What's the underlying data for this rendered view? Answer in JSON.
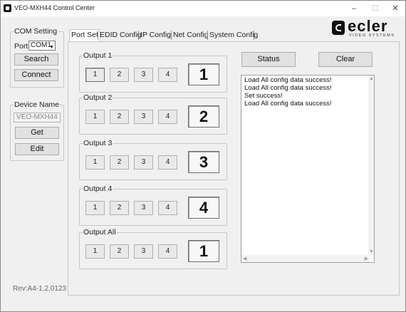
{
  "window": {
    "title": "VEO-MXH44 Control Center",
    "minimize": "–",
    "maximize": "☐",
    "close": "✕"
  },
  "com_setting": {
    "legend": "COM Setting",
    "port_label": "Port:",
    "port_value": "COM1",
    "search_label": "Search",
    "connect_label": "Connect"
  },
  "device_name": {
    "legend": "Device Name",
    "value": "VEO-MXH44",
    "get_label": "Get",
    "edit_label": "Edit"
  },
  "revision": "Rev:A4-1.2.0123",
  "logo": {
    "brand": "ecler",
    "tagline": "VIDEO SYSTEMS"
  },
  "tabs": [
    "Port Set",
    "EDID Config",
    "IP Config",
    "Net Config",
    "System Config"
  ],
  "active_tab": "Port Set",
  "outputs": [
    {
      "label": "Output 1",
      "inputs": [
        "1",
        "2",
        "3",
        "4"
      ],
      "selected": "1",
      "display": "1"
    },
    {
      "label": "Output 2",
      "inputs": [
        "1",
        "2",
        "3",
        "4"
      ],
      "selected": "",
      "display": "2"
    },
    {
      "label": "Output 3",
      "inputs": [
        "1",
        "2",
        "3",
        "4"
      ],
      "selected": "",
      "display": "3"
    },
    {
      "label": "Output 4",
      "inputs": [
        "1",
        "2",
        "3",
        "4"
      ],
      "selected": "",
      "display": "4"
    },
    {
      "label": "Output All",
      "inputs": [
        "1",
        "2",
        "3",
        "4"
      ],
      "selected": "",
      "display": "1"
    }
  ],
  "status_label": "Status",
  "clear_label": "Clear",
  "log_lines": [
    "Load All config data success!",
    "Load All config data success!",
    "Set success!",
    "Load All config data success!"
  ]
}
